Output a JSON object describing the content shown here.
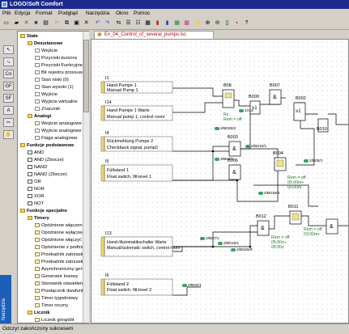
{
  "window": {
    "title": "LOGO!Soft Comfort"
  },
  "menu": [
    "Plik",
    "Edycja",
    "Format",
    "Podgląd",
    "Narzędzia",
    "Okno",
    "Pomoc"
  ],
  "document_tab": "Ex_04_Control_of_several_pumps.lsc",
  "side_tab": "Narzędzia",
  "tree": [
    {
      "label": "Stałe",
      "level": 0,
      "bold": true,
      "icon": "folder"
    },
    {
      "label": "Dwustanowe",
      "level": 1,
      "bold": true,
      "icon": "folder"
    },
    {
      "label": "Wejście",
      "level": 2,
      "icon": "item"
    },
    {
      "label": "Przyciski kursora",
      "level": 2,
      "icon": "item"
    },
    {
      "label": "Przyciski Funkcyjne (",
      "level": 2,
      "icon": "item"
    },
    {
      "label": "Bit rejestru przesuw",
      "level": 2,
      "icon": "item"
    },
    {
      "label": "Stan niski (0)",
      "level": 2,
      "icon": "item"
    },
    {
      "label": "Stan wysoki (1)",
      "level": 2,
      "icon": "item"
    },
    {
      "label": "Wyjście",
      "level": 2,
      "icon": "item"
    },
    {
      "label": "Wyjście wirtualne",
      "level": 2,
      "icon": "item"
    },
    {
      "label": "Znacznik",
      "level": 2,
      "icon": "item"
    },
    {
      "label": "Analogi",
      "level": 1,
      "bold": true,
      "icon": "folder"
    },
    {
      "label": "Wejście analogowe",
      "level": 2,
      "icon": "item"
    },
    {
      "label": "Wyjście analogowe",
      "level": 2,
      "icon": "item"
    },
    {
      "label": "Flaga analogowa",
      "level": 2,
      "icon": "item"
    },
    {
      "label": "Funkcje podstawowe",
      "level": 0,
      "bold": true,
      "icon": "folder"
    },
    {
      "label": "AND",
      "level": 1,
      "icon": "gate"
    },
    {
      "label": "AND (Zbocze)",
      "level": 1,
      "icon": "gate"
    },
    {
      "label": "NAND",
      "level": 1,
      "icon": "gate"
    },
    {
      "label": "NAND (Zbocze)",
      "level": 1,
      "icon": "gate"
    },
    {
      "label": "OR",
      "level": 1,
      "icon": "gate"
    },
    {
      "label": "NOR",
      "level": 1,
      "icon": "gate"
    },
    {
      "label": "XOR",
      "level": 1,
      "icon": "gate"
    },
    {
      "label": "NOT",
      "level": 1,
      "icon": "gate"
    },
    {
      "label": "Funkcje specjalne",
      "level": 0,
      "bold": true,
      "icon": "folder"
    },
    {
      "label": "Timery",
      "level": 1,
      "bold": true,
      "icon": "folder"
    },
    {
      "label": "Opóźnione włączeni",
      "level": 2,
      "icon": "tmr"
    },
    {
      "label": "Opóźnione wyłączen",
      "level": 2,
      "icon": "tmr"
    },
    {
      "label": "Opóźnione włączyć",
      "level": 2,
      "icon": "tmr"
    },
    {
      "label": "Opóźnienie z podtrz",
      "level": 2,
      "icon": "tmr"
    },
    {
      "label": "Przekaźnik zatrzask",
      "level": 2,
      "icon": "tmr"
    },
    {
      "label": "Przekaźnik zatrzask",
      "level": 2,
      "icon": "tmr"
    },
    {
      "label": "Asynchroniczny gen",
      "level": 2,
      "icon": "tmr"
    },
    {
      "label": "Generator losowy",
      "level": 2,
      "icon": "tmr"
    },
    {
      "label": "Sterownik oświetlen",
      "level": 2,
      "icon": "tmr"
    },
    {
      "label": "Przełącznik dwufunk",
      "level": 2,
      "icon": "tmr"
    },
    {
      "label": "Timer tygodniowy",
      "level": 2,
      "icon": "tmr"
    },
    {
      "label": "Timer roczny",
      "level": 2,
      "icon": "tmr"
    },
    {
      "label": "Licznik",
      "level": 1,
      "bold": true,
      "icon": "folder"
    },
    {
      "label": "Licznik górą/dół",
      "level": 2,
      "icon": "tmr"
    }
  ],
  "diagram": {
    "inputs": [
      {
        "id": "I1",
        "name": "Hand Pumpe 1",
        "desc": "Manual Pump 1"
      },
      {
        "id": "I14",
        "name": "Hand Pumpe 1 Warte",
        "desc": "Manual pump 1, control room"
      },
      {
        "id": "I4",
        "name": "Rückmeldung Pumpe 2",
        "desc": "Checkback signal, pump2"
      },
      {
        "id": "I5",
        "name": "Füllstand 1",
        "desc": "Float switch, fill-level 1"
      },
      {
        "id": "I13",
        "name": "Hand-/Automatikschalter Warte",
        "desc": "Manual/automatic switch, control room"
      },
      {
        "id": "I6",
        "name": "Füllstand 2",
        "desc": "Float switch, fill-level 2"
      }
    ],
    "blocks": [
      "B08",
      "B009",
      "B007",
      "B003",
      "B006",
      "B004",
      "B002",
      "B010",
      "B012",
      "B011"
    ],
    "block_symbols": {
      "and": "&",
      "or": "≥1"
    },
    "rs_labels": [
      "Rs",
      "Rem = off"
    ],
    "param_groups": [
      [
        "Rem = off",
        "05:00m+",
        "05:00m"
      ],
      [
        "Rem = off",
        "05:00s+",
        "05:00s"
      ],
      [
        "Rem = off",
        "03:00m+"
      ]
    ],
    "refs": [
      "1/I13",
      "2/B028/2",
      "2/B010/1",
      "3/B03/1",
      "2/B05/1",
      "2/B015/4",
      "2/B07/1",
      "2/B018/1",
      "2/B028/R",
      "2/B04/1"
    ]
  },
  "status": "Odczyt zakończony sukcesem"
}
